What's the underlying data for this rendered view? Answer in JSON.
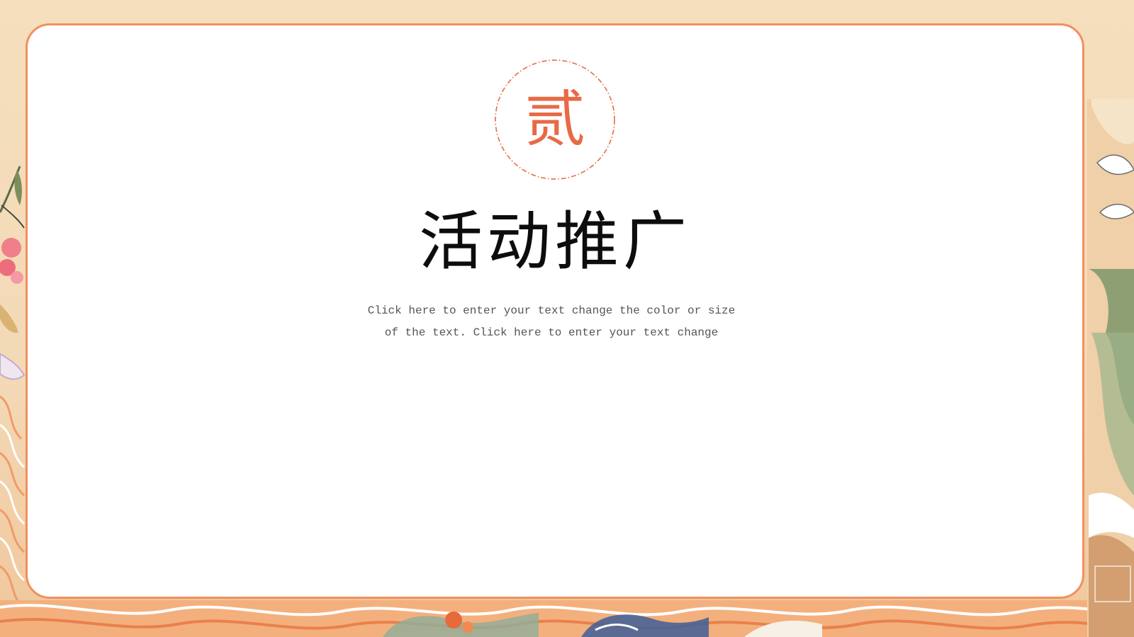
{
  "slide": {
    "section_number": "贰",
    "title": "活动推广",
    "body_lines": [
      "Click here to enter your text change the color or size",
      "of the text. Click here to enter your text change"
    ]
  },
  "colors": {
    "accent": "#f1905e",
    "numeral": "#e86a45",
    "card": "#ffffff",
    "background": "#f6dfbc",
    "title_text": "#0d0d0d",
    "body_text": "#555555"
  }
}
